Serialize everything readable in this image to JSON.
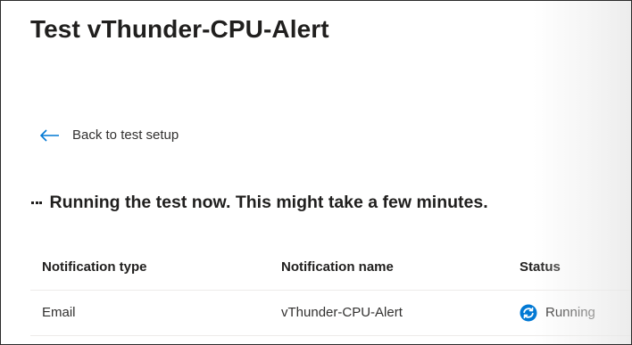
{
  "page": {
    "title": "Test vThunder-CPU-Alert"
  },
  "back_link": {
    "label": "Back to test setup",
    "icon": "arrow-left-icon"
  },
  "status_message": {
    "text": "Running the test now. This might take a few minutes.",
    "icon": "ellipsis-icon"
  },
  "table": {
    "columns": [
      "Notification type",
      "Notification name",
      "Status"
    ],
    "rows": [
      {
        "type": "Email",
        "name": "vThunder-CPU-Alert",
        "status": "Running",
        "status_icon": "sync-icon"
      }
    ]
  },
  "colors": {
    "accent": "#0078d4",
    "text": "#323130",
    "title": "#201f1e",
    "divider": "#edebe9"
  }
}
